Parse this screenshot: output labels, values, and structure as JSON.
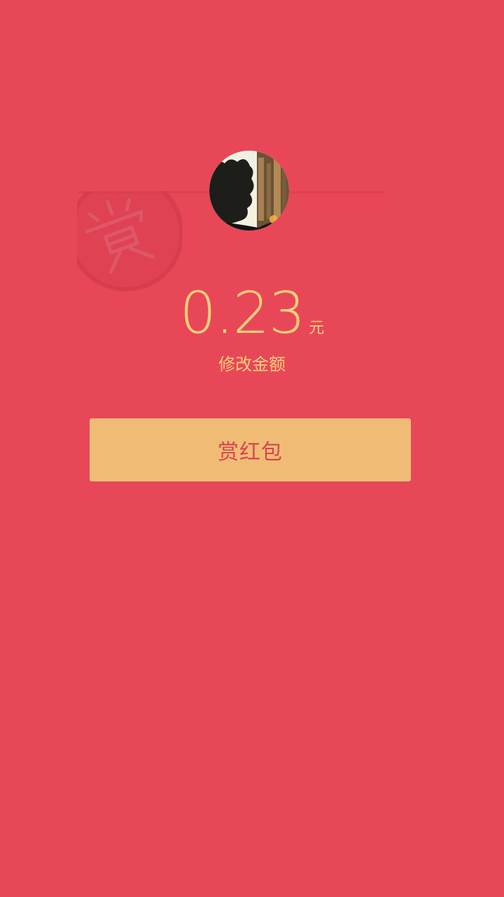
{
  "amount": {
    "value": "0.23",
    "unit": "元",
    "edit_label": "修改金额"
  },
  "reward_button": {
    "label": "赏红包"
  },
  "stamp": {
    "text": "赏"
  },
  "avatar": {
    "icon": "user-avatar-photo"
  },
  "colors": {
    "background": "#E84758",
    "accent_gold": "#F8D07A",
    "button_bg": "#F0BC75",
    "button_text": "#D9434F"
  }
}
